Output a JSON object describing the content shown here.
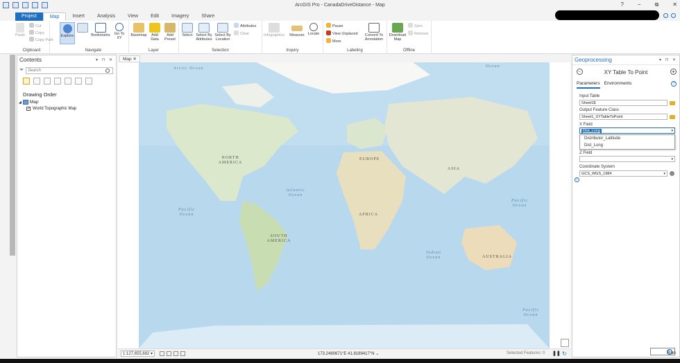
{
  "app": {
    "title": "ArcGIS Pro - CanadaDriveDistance - Map",
    "help": "?",
    "minimize": "−",
    "restore": "⧉",
    "close": "✕"
  },
  "ribbon_tabs": [
    "Project",
    "Map",
    "Insert",
    "Analysis",
    "View",
    "Edit",
    "Imagery",
    "Share"
  ],
  "ribbon": {
    "clipboard": {
      "label": "Clipboard",
      "paste": "Paste",
      "cut": "Cut",
      "copy": "Copy",
      "copy_path": "Copy Path"
    },
    "navigate": {
      "label": "Navigate",
      "explore": "Explore",
      "bookmarks": "Bookmarks",
      "go_to_xy": "Go To XY"
    },
    "layer": {
      "label": "Layer",
      "basemap": "Basemap",
      "add_data": "Add Data",
      "add_preset": "Add Preset"
    },
    "selection": {
      "label": "Selection",
      "select": "Select",
      "select_by_attributes": "Select By Attributes",
      "select_by_location": "Select By Location",
      "attributes": "Attributes",
      "clear": "Clear"
    },
    "inquiry": {
      "label": "Inquiry",
      "infographics": "Infographics",
      "measure": "Measure",
      "locate": "Locate"
    },
    "labeling": {
      "label": "Labeling",
      "pause": "Pause",
      "view_unplaced": "View Unplaced",
      "more": "More",
      "convert_to_annotation": "Convert To Annotation"
    },
    "offline": {
      "label": "Offline",
      "download_map": "Download Map",
      "sync": "Sync",
      "remove": "Remove"
    }
  },
  "contents": {
    "title": "Contents",
    "search_placeholder": "Search",
    "drawing_order": "Drawing Order",
    "map_label": "Map",
    "layer_label": "World Topographic Map"
  },
  "map_view": {
    "tab": "Map",
    "scale": "1:127,655,682",
    "coordinates": "173.2480671°E 41.8189417°N",
    "selected_features": "Selected Features: 0",
    "labels": {
      "arctic": "Arctic Ocean",
      "ocean_top": "Ocean",
      "north_america": "NORTH AMERICA",
      "europe": "EUROPE",
      "asia": "ASIA",
      "atlantic": "Atlantic Ocean",
      "africa": "AFRICA",
      "pacific_left": "Pacific Ocean",
      "pacific_right": "Pacific Ocean",
      "south_america": "SOUTH AMERICA",
      "indian": "Indian Ocean",
      "australia": "AUSTRALIA",
      "pacific_bottom": "Pacific Ocean"
    }
  },
  "geoprocessing": {
    "pane_title": "Geoprocessing",
    "tool_title": "XY Table To Point",
    "tab_parameters": "Parameters",
    "tab_environments": "Environments",
    "input_table_label": "Input Table",
    "input_table_value": "Sheet1$",
    "output_fc_label": "Output Feature Class",
    "output_fc_value": "Sheet1_XYTableToPoint",
    "x_field_label": "X Field",
    "x_field_value": "Dist_Long",
    "x_field_options": [
      "Distributor_Latitude",
      "Dist_Long"
    ],
    "z_field_label": "Z Field",
    "coord_sys_label": "Coordinate System",
    "coord_sys_value": "GCS_WGS_1984",
    "run": "Run"
  }
}
